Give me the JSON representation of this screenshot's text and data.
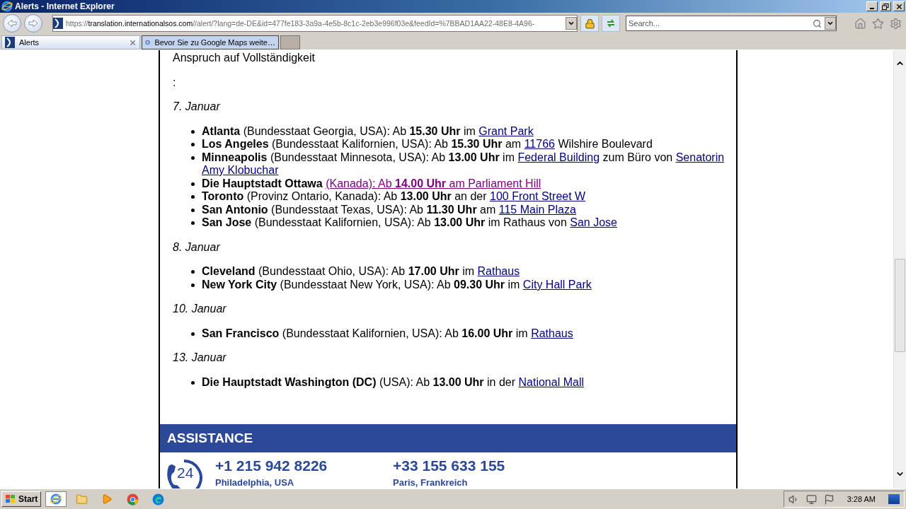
{
  "window": {
    "title": "Alerts - Internet Explorer"
  },
  "address_bar": {
    "scheme": "https://",
    "host": "translation.internationalsos.com",
    "path": "//alert/?lang=de-DE&id=477fe183-3a9a-4e5b-8c1c-2eb3e996f03e&feedId=%7BBAD1AA22-48E8-4A96-"
  },
  "search": {
    "placeholder": "Search..."
  },
  "tabs": [
    {
      "label": "Alerts",
      "selected": true
    },
    {
      "label": "Bevor Sie zu Google Maps weite…",
      "selected": false
    }
  ],
  "content": {
    "intro": [
      "Anspruch auf Vollständigkeit",
      ":"
    ],
    "sections": [
      {
        "date": "7. Januar",
        "items": [
          [
            {
              "kind": "text",
              "text": "**Atlanta** (Bundesstaat Georgia, USA): Ab **15.30 Uhr** im "
            },
            {
              "kind": "link",
              "text": "Grant Park",
              "visited": false
            }
          ],
          [
            {
              "kind": "text",
              "text": "**Los Angeles** (Bundesstaat Kalifornien, USA): Ab **15.30 Uhr** am "
            },
            {
              "kind": "link",
              "text": "11766",
              "visited": false
            },
            {
              "kind": "text",
              "text": " Wilshire Boulevard"
            }
          ],
          [
            {
              "kind": "text",
              "text": "**Minneapolis** (Bundesstaat Minnesota, USA): Ab **13.00 Uhr** im "
            },
            {
              "kind": "link",
              "text": "Federal Building",
              "visited": false
            },
            {
              "kind": "text",
              "text": " zum Büro von "
            },
            {
              "kind": "link",
              "text": "Senatorin",
              "visited": false
            },
            {
              "kind": "link",
              "text": "Amy Klobuchar",
              "visited": false
            }
          ],
          [
            {
              "kind": "text",
              "text": "**Die Hauptstadt Ottawa** "
            },
            {
              "kind": "link",
              "text": "(Kanada): Ab **14.00 Uhr** am Parliament Hill",
              "visited": true
            }
          ],
          [
            {
              "kind": "text",
              "text": "**Toronto** (Provinz Ontario, Kanada): Ab **13.00 Uhr** an der "
            },
            {
              "kind": "link",
              "text": "100 Front Street W",
              "visited": false
            }
          ],
          [
            {
              "kind": "text",
              "text": "**San Antonio** (Bundesstaat Texas, USA): Ab **11.30 Uhr** am "
            },
            {
              "kind": "link",
              "text": "115 Main Plaza",
              "visited": false
            }
          ],
          [
            {
              "kind": "text",
              "text": "**San Jose** (Bundesstaat Kalifornien, USA): Ab **13.00 Uhr** im Rathaus von "
            },
            {
              "kind": "link",
              "text": "San Jose",
              "visited": false
            }
          ]
        ]
      },
      {
        "date": "8. Januar",
        "items": [
          [
            {
              "kind": "text",
              "text": "**Cleveland** (Bundesstaat Ohio, USA): Ab **17.00 Uhr** im "
            },
            {
              "kind": "link",
              "text": "Rathaus",
              "visited": false
            }
          ],
          [
            {
              "kind": "text",
              "text": "**New York City** (Bundesstaat New York, USA): Ab **09.30 Uhr** im "
            },
            {
              "kind": "link",
              "text": "City Hall Park",
              "visited": false
            }
          ]
        ]
      },
      {
        "date": "10. Januar",
        "items": [
          [
            {
              "kind": "text",
              "text": "**San Francisco** (Bundesstaat Kalifornien, USA): Ab **16.00 Uhr** im "
            },
            {
              "kind": "link",
              "text": "Rathaus",
              "visited": false
            }
          ]
        ]
      },
      {
        "date": "13. Januar",
        "items": [
          [
            {
              "kind": "text",
              "text": "**Die Hauptstadt Washington (DC)** (USA): Ab **13.00 Uhr** in der "
            },
            {
              "kind": "link",
              "text": "National Mall",
              "visited": false
            }
          ]
        ]
      }
    ]
  },
  "assistance": {
    "title": "ASSISTANCE",
    "contacts": [
      {
        "phone": "+1 215 942 8226",
        "city": "Philadelphia, USA"
      },
      {
        "phone": "+33 155 633 155",
        "city": "Paris, Frankreich"
      }
    ],
    "badge": "24"
  },
  "taskbar": {
    "start": "Start",
    "apps": [
      {
        "kind": "ie",
        "active": true
      },
      {
        "kind": "folder",
        "active": false
      },
      {
        "kind": "media",
        "active": false
      },
      {
        "kind": "chrome",
        "active": false
      },
      {
        "kind": "edge",
        "active": false
      }
    ],
    "clock": "3:28 AM"
  }
}
